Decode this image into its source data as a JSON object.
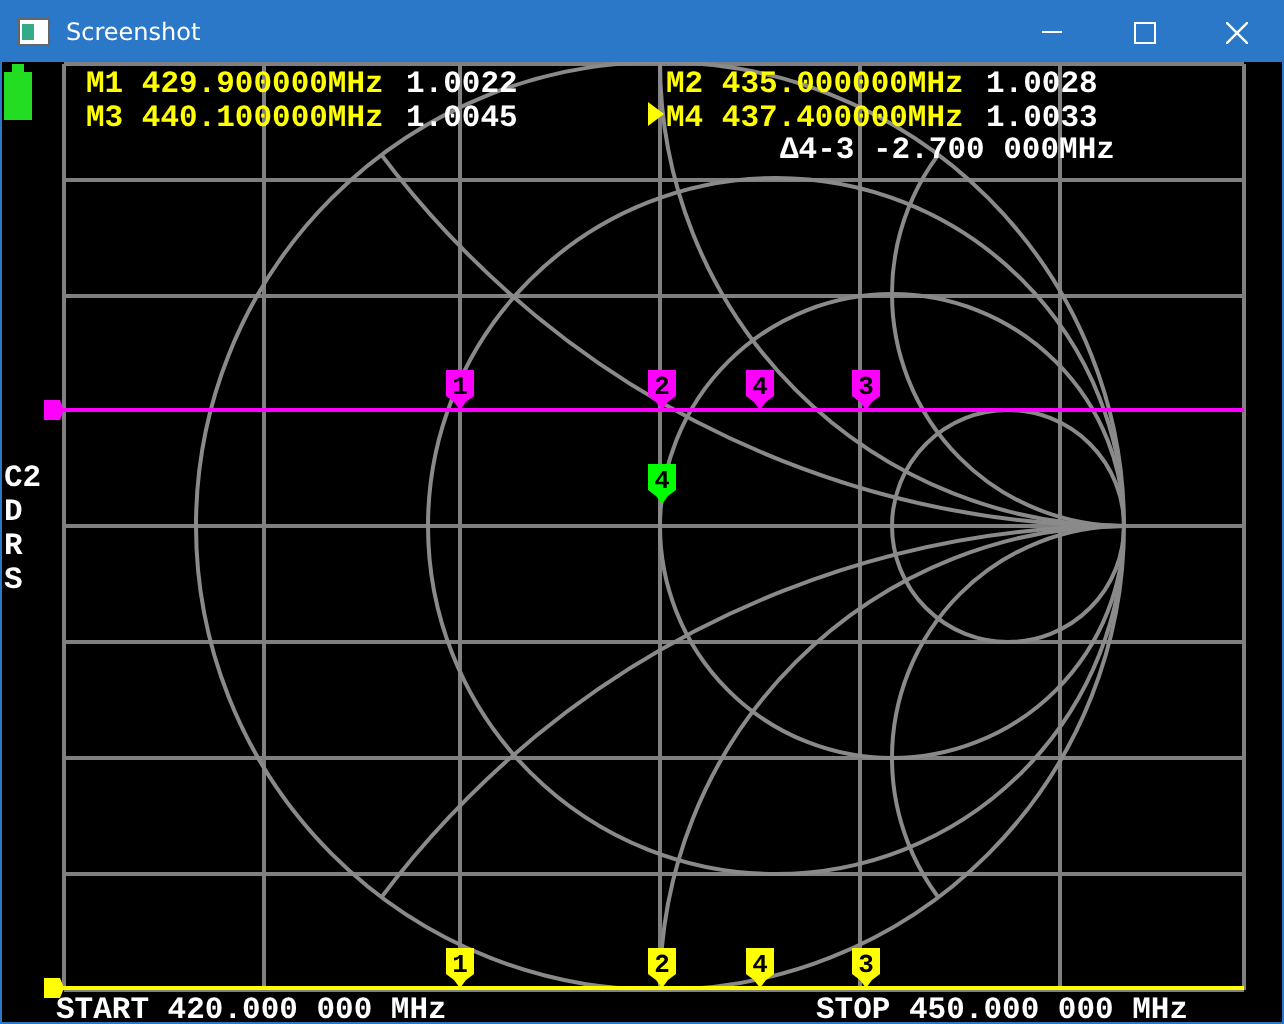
{
  "window": {
    "title": "Screenshot"
  },
  "markers": [
    {
      "label": "M1",
      "frequency": "429.900000MHz",
      "value": "1.0022",
      "selected": false
    },
    {
      "label": "M2",
      "frequency": "435.000000MHz",
      "value": "1.0028",
      "selected": false
    },
    {
      "label": "M3",
      "frequency": "440.100000MHz",
      "value": "1.0045",
      "selected": false
    },
    {
      "label": "M4",
      "frequency": "437.400000MHz",
      "value": "1.0033",
      "selected": true
    }
  ],
  "delta": "Δ4-3 -2.700 000MHz",
  "side_labels": [
    "C2",
    "D",
    "R",
    "S"
  ],
  "traces": [
    {
      "kind": "line",
      "color": "#ff00ff",
      "markers": [
        "1",
        "2",
        "4",
        "3"
      ]
    },
    {
      "kind": "point",
      "color": "#00ff00",
      "markers": [
        "4"
      ]
    },
    {
      "kind": "line",
      "color": "#ffff00",
      "markers": [
        "1",
        "2",
        "4",
        "3"
      ]
    }
  ],
  "sweep": {
    "start": "START 420.000 000 MHz",
    "stop": "STOP 450.000 000 MHz"
  }
}
